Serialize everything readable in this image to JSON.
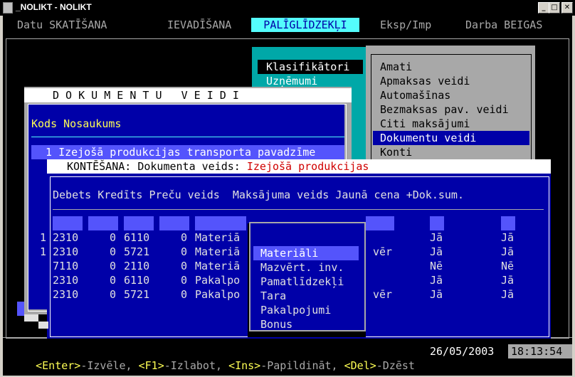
{
  "window": {
    "title": "_NOLIKT - NOLIKT",
    "min": "_",
    "max": "□",
    "close": "✕"
  },
  "menu": {
    "datu": "Datu SKATĪŠANA",
    "ievad": "IEVADĪŠANA",
    "palig": "PALĪGLĪDZEKĻI",
    "eksp": "Eksp/Imp",
    "darba": "Darba BEIGAS"
  },
  "palig_menu": {
    "klasif": "Klasifikātori",
    "uzn": "Uzņēmumi"
  },
  "klasif_menu": [
    "Amati",
    "Apmaksas veidi",
    "Automašīnas",
    "Bezmaksas pav. veidi",
    "Citi maksājumi",
    "Dokumentu veidi",
    "Konti"
  ],
  "dok_window": {
    "title": "D O K U M E N T U   V E I D I",
    "header": "Kods Nosaukums",
    "row_num": "1",
    "row_name": "Izejošā produkcijas transporta pavadzīme"
  },
  "kont": {
    "title_prefix": "KONTĒŠANA: Dokumenta veids: ",
    "title_value": "Izejošā produkcijas",
    "header": "Debets Kredīts Preču veids  Maksājuma veids Jaunā cena +Dok.sum.",
    "rows": [
      {
        "deb": "2310",
        "n1": "0",
        "kred": "6110",
        "n2": "0",
        "prec": "Materiā",
        "mv": "",
        "jc": "Jā",
        "ds": "Jā"
      },
      {
        "deb": "2310",
        "n1": "0",
        "kred": "5721",
        "n2": "0",
        "prec": "Materiā",
        "mv": "vēr",
        "jc": "Jā",
        "ds": "Jā"
      },
      {
        "deb": "7110",
        "n1": "0",
        "kred": "2110",
        "n2": "0",
        "prec": "Materiā",
        "mv": "",
        "jc": "Nē",
        "ds": "Nē"
      },
      {
        "deb": "2310",
        "n1": "0",
        "kred": "6110",
        "n2": "0",
        "prec": "Pakalpo",
        "mv": "",
        "jc": "Jā",
        "ds": "Jā"
      },
      {
        "deb": "2310",
        "n1": "0",
        "kred": "5721",
        "n2": "0",
        "prec": "Pakalpo",
        "mv": "vēr",
        "jc": "Jā",
        "ds": "Jā"
      }
    ],
    "side_nums": [
      "1",
      "1"
    ]
  },
  "prec_dropdown": [
    "Materiāli",
    "Mazvērt. inv.",
    "Pamatlīdzekļi",
    "Tara",
    "Pakalpojumi",
    "Bonus"
  ],
  "status": {
    "enter_key": "<Enter>",
    "enter_txt": "-Izvēle, ",
    "f1_key": "<F1>",
    "f1_txt": "-Izlabot, ",
    "ins_key": "<Ins>",
    "ins_txt": "-Papildināt, ",
    "del_key": "<Del>",
    "del_txt": "-Dzēst",
    "date": "26/05/2003",
    "time": "18:13:54"
  }
}
